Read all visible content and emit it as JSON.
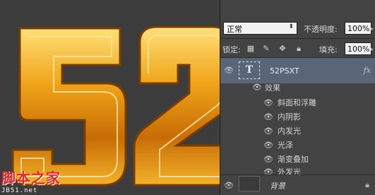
{
  "canvas": {
    "glyphs": "52",
    "watermark_cn": "脚本之家",
    "watermark_url": "JB51.net"
  },
  "panel": {
    "blend_mode": "正常",
    "opacity_label": "不透明度:",
    "opacity_value": "100%",
    "lock_label": "锁定:",
    "fill_label": "填充:",
    "fill_value": "100%",
    "layers": [
      {
        "name": "52PSXT",
        "type_glyph": "T",
        "fx_label": "fx",
        "effects_label": "效果",
        "effects": [
          "斜面和浮雕",
          "内阴影",
          "内发光",
          "光泽",
          "渐变叠加",
          "外发光"
        ]
      },
      {
        "name": "背景"
      }
    ]
  },
  "colors": {
    "canvas_bg": "#3c3c3c",
    "gold": "#e49a12",
    "gold_light": "#ffd55a",
    "panel_bg": "#434343",
    "selection": "#5a6678"
  }
}
